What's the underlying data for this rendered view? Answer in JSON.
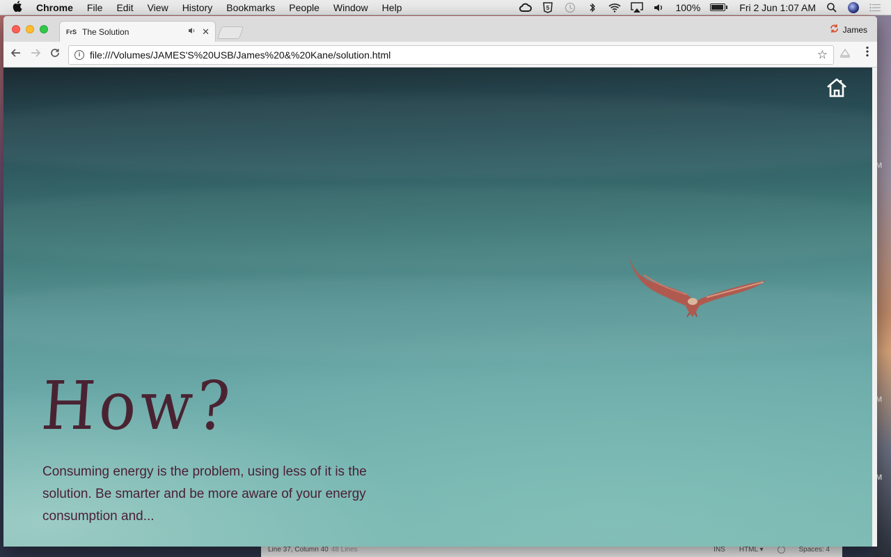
{
  "menubar": {
    "apple": "",
    "app_name": "Chrome",
    "items": [
      "File",
      "Edit",
      "View",
      "History",
      "Bookmarks",
      "People",
      "Window",
      "Help"
    ],
    "battery": "100%",
    "clock": "Fri 2 Jun  1:07 AM"
  },
  "browser": {
    "tab": {
      "favicon": "FrS",
      "title": "The Solution"
    },
    "profile_name": "James",
    "url": "file:///Volumes/JAMES'S%20USB/James%20&%20Kane/solution.html"
  },
  "page": {
    "heading": "How?",
    "body": "Consuming energy is the problem, using less of it is the solution. Be smarter and be more aware of your energy consumption and..."
  },
  "editor": {
    "position": "Line 37, Column 40",
    "lines": "48 Lines",
    "mode": "INS",
    "language": "HTML",
    "spaces": "Spaces: 4",
    "gutter_marks": [
      "M",
      "M",
      "M"
    ]
  }
}
